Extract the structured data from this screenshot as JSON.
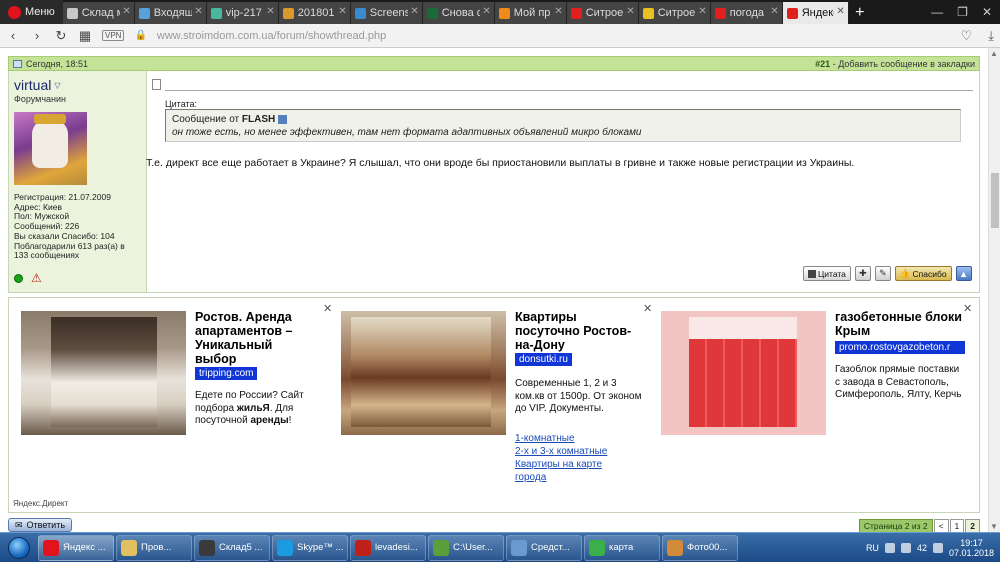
{
  "browser": {
    "menu_label": "Меню",
    "tabs": [
      {
        "title": "Склад м",
        "color": "#c8c8c8",
        "active": false
      },
      {
        "title": "Входящ",
        "color": "#5aa0d8",
        "active": false
      },
      {
        "title": "vip-217",
        "color": "#4ab8a0",
        "active": false
      },
      {
        "title": "201801",
        "color": "#d89a2a",
        "active": false
      },
      {
        "title": "Screens",
        "color": "#3a8ad0",
        "active": false
      },
      {
        "title": "Снова с",
        "color": "#1a6a3a",
        "active": false
      },
      {
        "title": "Мой пр",
        "color": "#f08a1a",
        "active": false
      },
      {
        "title": "Ситрое",
        "color": "#e0201a",
        "active": false
      },
      {
        "title": "Ситрое",
        "color": "#e8c020",
        "active": false
      },
      {
        "title": "погода",
        "color": "#e0201a",
        "active": false
      },
      {
        "title": "Яндекс",
        "color": "#e0201a",
        "active": true
      }
    ],
    "url_host": "www.stroimdom.com.ua",
    "url_path": "/forum/showthread.php",
    "vpn_label": "VPN"
  },
  "post": {
    "date": "Сегодня, 18:51",
    "number": "#21",
    "bookmark_text": "- Добавить сообщение в закладки",
    "username": "virtual",
    "user_title": "Форумчанин",
    "info": [
      "Регистрация: 21.07.2009",
      "Адрес: Киев",
      "Пол: Мужской",
      "Сообщений: 226",
      "Вы сказали Спасибо: 104",
      "Поблагодарили 613 раз(а) в",
      "133 сообщениях"
    ],
    "quote_label": "Цитата:",
    "quote_prefix": "Сообщение от",
    "quote_author": "FLASH",
    "quote_text": "он тоже есть, но менее эффективен, там нет формата адаптивных объявлений микро блоками",
    "message": "Т.е. директ все еще работает в Украине? Я слышал, что они вроде бы приостановили выплаты в гривне и также новые регистрации из Украины.",
    "quote_btn": "Цитата",
    "thanks_btn": "Спасибо"
  },
  "ads": {
    "label": "Яндекс.Директ",
    "items": [
      {
        "title": "Ростов. Аренда апартаментов – Уникальный выбор",
        "domain": "tripping.com",
        "desc_parts": [
          "Едете по России? Сайт подбора ",
          "жильЯ",
          ". Для посуточной ",
          "аренды",
          "!"
        ],
        "links": []
      },
      {
        "title": "Квартиры посуточно Ростов-на-Дону",
        "domain": "donsutki.ru",
        "desc": "Современные 1, 2 и 3 ком.кв от 1500р. От эконом до VIP. Документы.",
        "links": [
          "1-комнатные",
          "2-х и 3-х комнатные",
          "Квартиры на карте города"
        ]
      },
      {
        "title": "газобетонные блоки Крым",
        "domain": "promo.rostovgazobeton.r",
        "desc": "Газоблок прямые поставки с завода в Севастополь, Симферополь, Ялту, Керчь",
        "links": []
      }
    ]
  },
  "footer": {
    "reply_btn": "Ответить",
    "page_label": "Страница 2 из 2",
    "prev": "<",
    "page1": "1",
    "page2": "2"
  },
  "taskbar": {
    "items": [
      {
        "label": "Яндекс ...",
        "color": "#e1141e",
        "active": true
      },
      {
        "label": "Пров...",
        "color": "#e0c060",
        "active": false
      },
      {
        "label": "Склад5 ...",
        "color": "#3a3a3a",
        "active": false
      },
      {
        "label": "Skype™ ...",
        "color": "#1a9ae0",
        "active": false
      },
      {
        "label": "levadesi...",
        "color": "#c0201a",
        "active": false
      },
      {
        "label": "C:\\User...",
        "color": "#5aa03a",
        "active": false
      },
      {
        "label": "Средст...",
        "color": "#6a9ad0",
        "active": false
      },
      {
        "label": "карта",
        "color": "#3ab04a",
        "active": false
      },
      {
        "label": "Фото00...",
        "color": "#d08a3a",
        "active": false
      }
    ],
    "lang": "RU",
    "tray_num": "42",
    "time": "19:17",
    "date": "07.01.2018"
  }
}
